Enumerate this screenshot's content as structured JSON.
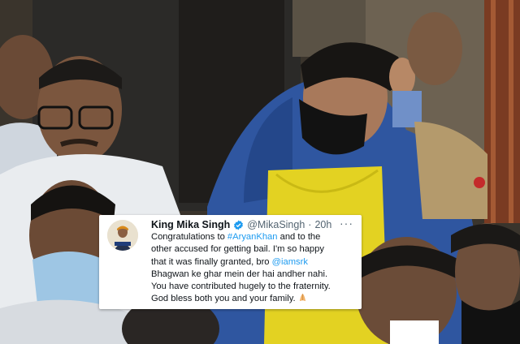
{
  "tweet": {
    "display_name": "King Mika Singh",
    "handle": "@MikaSingh",
    "separator": "·",
    "time": "20h",
    "more": "···",
    "lines": {
      "l1_pre": "Congratulations to ",
      "l1_tag": "#AryanKhan",
      "l1_post": " and to the",
      "l2": "other accused for getting bail. I'm so happy",
      "l3_pre": "that it was finally granted, bro ",
      "l3_mention": "@iamsrk",
      "l4": "Bhagwan ke ghar mein der hai andher nahi.",
      "l5": "You have contributed hugely to the fraternity.",
      "l6": "God bless both you and your family. "
    },
    "verified_icon": "verified-badge-icon",
    "emoji_icon": "folded-hands-icon",
    "link_color": "#1d9bf0",
    "verified_color": "#1d9bf0"
  }
}
